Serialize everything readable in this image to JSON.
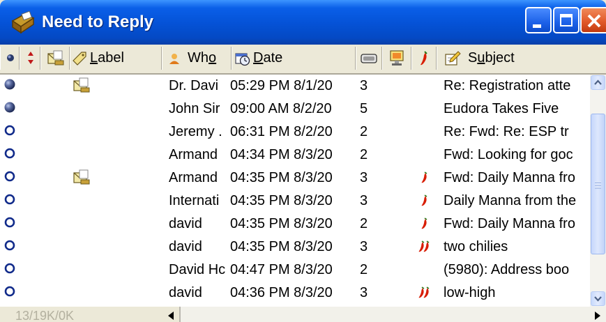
{
  "window": {
    "title": "Need to Reply",
    "icon": "mailbox-icon"
  },
  "title_buttons": {
    "minimize": "minimize-icon",
    "maximize": "maximize-icon",
    "close": "close-icon"
  },
  "columns": {
    "status": {
      "icon": "status-dot-icon"
    },
    "priority_sort": {
      "icon": "sort-arrows-icon"
    },
    "attachment": {
      "icon": "attachment-icon"
    },
    "label": {
      "icon": "tag-icon",
      "pre": "",
      "mnemonic": "L",
      "post": "abel"
    },
    "who": {
      "icon": "person-icon",
      "pre": "Wh",
      "mnemonic": "o",
      "post": ""
    },
    "date": {
      "icon": "clock-icon",
      "pre": "",
      "mnemonic": "D",
      "post": "ate"
    },
    "size": {
      "icon": "disk-icon"
    },
    "server": {
      "icon": "server-icon"
    },
    "mood": {
      "icon": "chili-icon"
    },
    "subject": {
      "icon": "pencil-icon",
      "pre": "S",
      "mnemonic": "u",
      "post": "bject"
    }
  },
  "messages": [
    {
      "status": "read",
      "attachment": true,
      "chilies": 0,
      "who": "Dr. Davi",
      "date": "05:29 PM 8/1/20",
      "size": "3",
      "subject": "Re: Registration atte"
    },
    {
      "status": "read",
      "attachment": false,
      "chilies": 0,
      "who": "John Sir",
      "date": "09:00 AM 8/2/20",
      "size": "5",
      "subject": "Eudora Takes Five"
    },
    {
      "status": "unread",
      "attachment": false,
      "chilies": 0,
      "who": "Jeremy .",
      "date": "06:31 PM 8/2/20",
      "size": "2",
      "subject": "Re: Fwd: Re: ESP tr"
    },
    {
      "status": "unread",
      "attachment": false,
      "chilies": 0,
      "who": "Armand",
      "date": "04:34 PM 8/3/20",
      "size": "2",
      "subject": "Fwd: Looking for goc"
    },
    {
      "status": "unread",
      "attachment": true,
      "chilies": 1,
      "who": "Armand",
      "date": "04:35 PM 8/3/20",
      "size": "3",
      "subject": "Fwd: Daily Manna fro"
    },
    {
      "status": "unread",
      "attachment": false,
      "chilies": 1,
      "who": "Internati",
      "date": "04:35 PM 8/3/20",
      "size": "3",
      "subject": "Daily Manna from the"
    },
    {
      "status": "unread",
      "attachment": false,
      "chilies": 1,
      "who": "david",
      "date": "04:35 PM 8/3/20",
      "size": "2",
      "subject": "Fwd: Daily Manna fro"
    },
    {
      "status": "unread",
      "attachment": false,
      "chilies": 2,
      "who": "david",
      "date": "04:35 PM 8/3/20",
      "size": "3",
      "subject": "two chilies"
    },
    {
      "status": "unread",
      "attachment": false,
      "chilies": 0,
      "who": "David Hc",
      "date": "04:47 PM 8/3/20",
      "size": "2",
      "subject": "(5980): Address boo"
    },
    {
      "status": "unread",
      "attachment": false,
      "chilies": 2,
      "who": "david",
      "date": "04:36 PM 8/3/20",
      "size": "3",
      "subject": "low-high"
    }
  ],
  "status_bar": {
    "text": "13/19K/0K"
  },
  "colors": {
    "title_bar": "#0553d8",
    "chrome": "#ece9d8",
    "chili": "#d81e05",
    "read_dot": "#3a4a78",
    "unread_ring": "#102a8a"
  }
}
